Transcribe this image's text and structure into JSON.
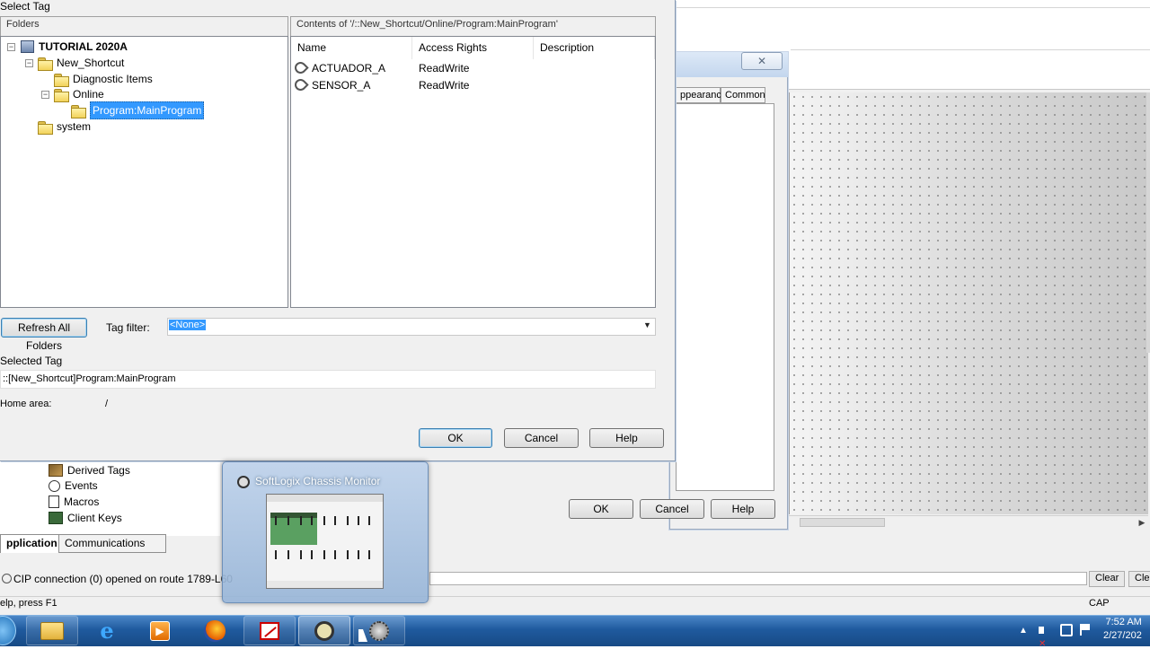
{
  "select_tag": {
    "title": "Select Tag",
    "folders_header": "Folders",
    "contents_header": "Contents of '/::New_Shortcut/Online/Program:MainProgram'",
    "tree": {
      "root": "TUTORIAL 2020A",
      "new_shortcut": "New_Shortcut",
      "diagnostic": "Diagnostic Items",
      "online": "Online",
      "main_program": "Program:MainProgram",
      "system": "system"
    },
    "columns": {
      "name": "Name",
      "access": "Access Rights",
      "description": "Description"
    },
    "rows": [
      {
        "name": "ACTUADOR_A",
        "access": "ReadWrite"
      },
      {
        "name": "SENSOR_A",
        "access": "ReadWrite"
      }
    ],
    "refresh_label": "Refresh All Folders",
    "tag_filter_label": "Tag filter:",
    "tag_filter_value": "<None>",
    "selected_tag_label": "Selected Tag",
    "selected_tag_value": "::[New_Shortcut]Program:MainProgram",
    "home_area_label": "Home area:",
    "home_area_value": "/",
    "ok": "OK",
    "cancel": "Cancel",
    "help": "Help"
  },
  "tag_dialog": {
    "close": "✕",
    "tab_appearance": "ppearance",
    "tab_common": "Common",
    "ok": "OK",
    "cancel": "Cancel",
    "help": "Help"
  },
  "explorer": {
    "items": [
      "Derived Tags",
      "Events",
      "Macros",
      "Client Keys"
    ],
    "tab_application": "pplication",
    "tab_communications": "Communications"
  },
  "output": {
    "message": "CIP connection (0) opened on route 1789-L60",
    "clear": "Clear",
    "clear2": "Clea"
  },
  "status": {
    "help_text": "elp, press F1",
    "cap": "CAP"
  },
  "thumbnail": {
    "title": "SoftLogix Chassis Monitor"
  },
  "taskbar": {
    "time": "7:52 AM",
    "date": "2/27/202"
  },
  "icons": [
    "start-orb-icon",
    "folder-explorer-icon",
    "ie-icon",
    "media-player-icon",
    "firefox-icon",
    "factorytalk-icon",
    "chassis-monitor-icon",
    "rslinx-icon",
    "speaker-icon",
    "network-icon",
    "flag-icon"
  ]
}
